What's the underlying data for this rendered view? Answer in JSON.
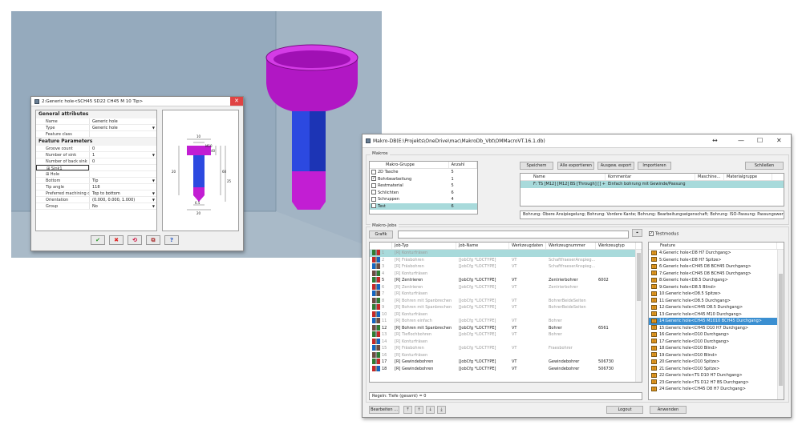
{
  "hole_dialog": {
    "title": "2:Generic hole<SCH45 SD22 CH45 M 10 Tip>",
    "section_general": "General attributes",
    "general_rows": [
      {
        "key": "Name",
        "value": "Generic hole"
      },
      {
        "key": "Type",
        "value": "Generic hole"
      },
      {
        "key": "Feature class",
        "value": ""
      }
    ],
    "section_feature": "Feature Parameters",
    "feature_rows": [
      {
        "key": "Groove count",
        "value": "0"
      },
      {
        "key": "Number of sink",
        "value": "1"
      },
      {
        "key": "Number of back sink",
        "value": "0"
      },
      {
        "key": "⊞ Sink1",
        "value": ""
      },
      {
        "key": "⊞ Hole",
        "value": ""
      },
      {
        "key": "Bottom",
        "value": "Tip"
      },
      {
        "key": "Tip angle",
        "value": "118"
      },
      {
        "key": "Preferred machining direct...",
        "value": "Top to bottom"
      },
      {
        "key": "Orientation",
        "value": "(0.000, 0.000, 1.000)"
      },
      {
        "key": "Group",
        "value": "No"
      }
    ],
    "dims": [
      "10",
      "40",
      "M10",
      "20",
      "60",
      "25",
      "6.5",
      "20"
    ],
    "buttons": {
      "ok": "✔",
      "cancel": "✖",
      "b3": "⟲",
      "b4": "⧉",
      "help": "?"
    }
  },
  "makro": {
    "title": "Makro-DB(E:\\Projekts\\OneDrive\\mac\\MakroDb_Vbt\\OMMacroVT.16.1.db)",
    "window_controls": {
      "restore": "↔",
      "min": "—",
      "max": "☐",
      "close": "✕"
    },
    "group_makros": "Makros",
    "group_headers": {
      "name": "Makro-Gruppe",
      "count": "Anzahl"
    },
    "groups": [
      {
        "check": "",
        "name": "2D Tasche",
        "count": "5"
      },
      {
        "check": "✓",
        "name": "Bohrbearbeitung",
        "count": "1"
      },
      {
        "check": "",
        "name": "Restmaterial",
        "count": "5"
      },
      {
        "check": "",
        "name": "Schlichten",
        "count": "6"
      },
      {
        "check": "",
        "name": "Schruppen",
        "count": "4"
      },
      {
        "check": "",
        "name": "Test",
        "count": "6"
      }
    ],
    "toolbar": {
      "save": "Speichern",
      "export_all": "Alle exportieren",
      "export_sel": "Ausgew. export",
      "import": "Importieren",
      "close": "Schließen"
    },
    "macro_headers": {
      "name": "Name",
      "comment": "Kommentar",
      "machine": "Maschine...",
      "material": "Materialgruppe"
    },
    "macros": [
      {
        "name": "F: TS [M12] [M12] BS [Through] [] + [...]",
        "comment": "Einfach bohrung mit Gewinde/Passung",
        "machine": "",
        "material": ""
      }
    ],
    "rule_text": "Bohrung: Obere Ansipiegelung; Bohrung: Vordere Kante; Bohrung: Bearbeitungseigenschaft; Bohrung: ISO-Passung: Passungswert; Bohr",
    "group_jobs": "Makro-Jobs",
    "graph_button": "Grafik",
    "job_headers": {
      "typ": "Job-Typ",
      "name": "Job-Name",
      "data": "Werkzeugdaten",
      "number": "Werkzeugnummer",
      "type": "Werkzeugtyp"
    },
    "jobs": [
      {
        "n": "1",
        "typ": "[R] Konturfräsen",
        "name": "",
        "data": "",
        "number": "",
        "type": "",
        "dim": true,
        "sel": true
      },
      {
        "n": "2",
        "typ": "[R] Fräsbohren",
        "name": "[JobCfg *LOCTYPE]",
        "data": "VT",
        "number": "SchaftfraeserAnspieg...",
        "type": "",
        "dim": true
      },
      {
        "n": "3",
        "typ": "[R] Fräsbohren",
        "name": "[JobCfg *LOCTYPE]",
        "data": "VT",
        "number": "SchaftfraeserAnspieg...",
        "type": "",
        "dim": true
      },
      {
        "n": "4",
        "typ": "[R] Konturfräsen",
        "name": "",
        "data": "",
        "number": "",
        "type": "",
        "dim": true
      },
      {
        "n": "5",
        "typ": "[R] Zentrieren",
        "name": "[JobCfg *LOCTYPE]",
        "data": "VT",
        "number": "Zentrierbohrer",
        "type": "6002",
        "dim": false
      },
      {
        "n": "6",
        "typ": "[R] Zentrieren",
        "name": "[JobCfg *LOCTYPE]",
        "data": "VT",
        "number": "Zentrierbohrer",
        "type": "",
        "dim": true
      },
      {
        "n": "7",
        "typ": "[R] Konturfräsen",
        "name": "",
        "data": "",
        "number": "",
        "type": "",
        "dim": true
      },
      {
        "n": "8",
        "typ": "[R] Bohren mit Spanbrechen",
        "name": "[JobCfg *LOCTYPE]",
        "data": "VT",
        "number": "BohrerBeideSeiten",
        "type": "",
        "dim": true
      },
      {
        "n": "9",
        "typ": "[R] Bohren mit Spanbrechen",
        "name": "[JobCfg *LOCTYPE]",
        "data": "VT",
        "number": "BohrerBeideSeiten",
        "type": "",
        "dim": true
      },
      {
        "n": "10",
        "typ": "[R] Konturfräsen",
        "name": "",
        "data": "",
        "number": "",
        "type": "",
        "dim": true
      },
      {
        "n": "11",
        "typ": "[R] Bohren einfach",
        "name": "[JobCfg *LOCTYPE]",
        "data": "VT",
        "number": "Bohrer",
        "type": "",
        "dim": true
      },
      {
        "n": "12",
        "typ": "[R] Bohren mit Spanbrechen",
        "name": "[JobCfg *LOCTYPE]",
        "data": "VT",
        "number": "Bohrer",
        "type": "6561",
        "dim": false
      },
      {
        "n": "13",
        "typ": "[R] Tieflochbohren",
        "name": "[JobCfg *LOCTYPE]",
        "data": "VT",
        "number": "Bohrer",
        "type": "",
        "dim": true
      },
      {
        "n": "14",
        "typ": "[R] Konturfräsen",
        "name": "",
        "data": "",
        "number": "",
        "type": "",
        "dim": true
      },
      {
        "n": "15",
        "typ": "[R] Fräsbohren",
        "name": "[JobCfg *LOCTYPE]",
        "data": "VT",
        "number": "Fraesbohrer",
        "type": "",
        "dim": true
      },
      {
        "n": "16",
        "typ": "[R] Konturfräsen",
        "name": "",
        "data": "",
        "number": "",
        "type": "",
        "dim": true
      },
      {
        "n": "17",
        "typ": "[R] Gewindebohren",
        "name": "[JobCfg *LOCTYPE]",
        "data": "VT",
        "number": "Gewindebohrer",
        "type": "506730",
        "dim": false
      },
      {
        "n": "18",
        "typ": "[R] Gewindebohren",
        "name": "[JobCfg *LOCTYPE]",
        "data": "VT",
        "number": "Gewindebohrer",
        "type": "506730",
        "dim": false
      }
    ],
    "jobs_status": "Regeln: Tiefe (gesamt) = 0",
    "testmode_label": "Testmodus",
    "feature_header": "Feature",
    "features": [
      "4:Generic hole<D8 H7 Durchgang>",
      "5:Generic hole<D8 H7 Spitze>",
      "6:Generic hole<CH45 D8 BCH45 Durchgang>",
      "7:Generic hole<CH45 D8 BCH45 Durchgang>",
      "8:Generic hole<D8.5 Durchgang>",
      "9:Generic hole<D8.5 Blind>",
      "10:Generic hole<D8.5 Spitze>",
      "11:Generic hole<D8.5 Durchgang>",
      "12:Generic hole<CH45 D8.5 Durchgang>",
      "13:Generic hole<CH45 M10 Durchgang>",
      "14:Generic hole<CH45 M1010 BCH45 Durchgang>",
      "15:Generic hole<CH45 D10 H7 Durchgang>",
      "16:Generic hole<D10 Durchgang>",
      "17:Generic hole<D10 Durchgang>",
      "18:Generic hole<D10 Blind>",
      "19:Generic hole<D10 Blind>",
      "20:Generic hole<D10 Spitze>",
      "21:Generic hole<D10 Spitze>",
      "22:Generic hole<TS D10 H7 Durchgang>",
      "23:Generic hole<TS D12 H7 BS Durchgang>",
      "24:Generic hole<CH45 D8 H7 Durchgang>"
    ],
    "selected_feature_index": 10,
    "bottom": {
      "edit": "Bearbeiten ...",
      "logout": "Logout",
      "apply": "Anwenden"
    }
  },
  "colors": {
    "accent_select": "#a8dadb",
    "feature_select": "#3b8fd1",
    "part_magenta": "#c21ed3",
    "part_blue": "#2c49e0"
  }
}
